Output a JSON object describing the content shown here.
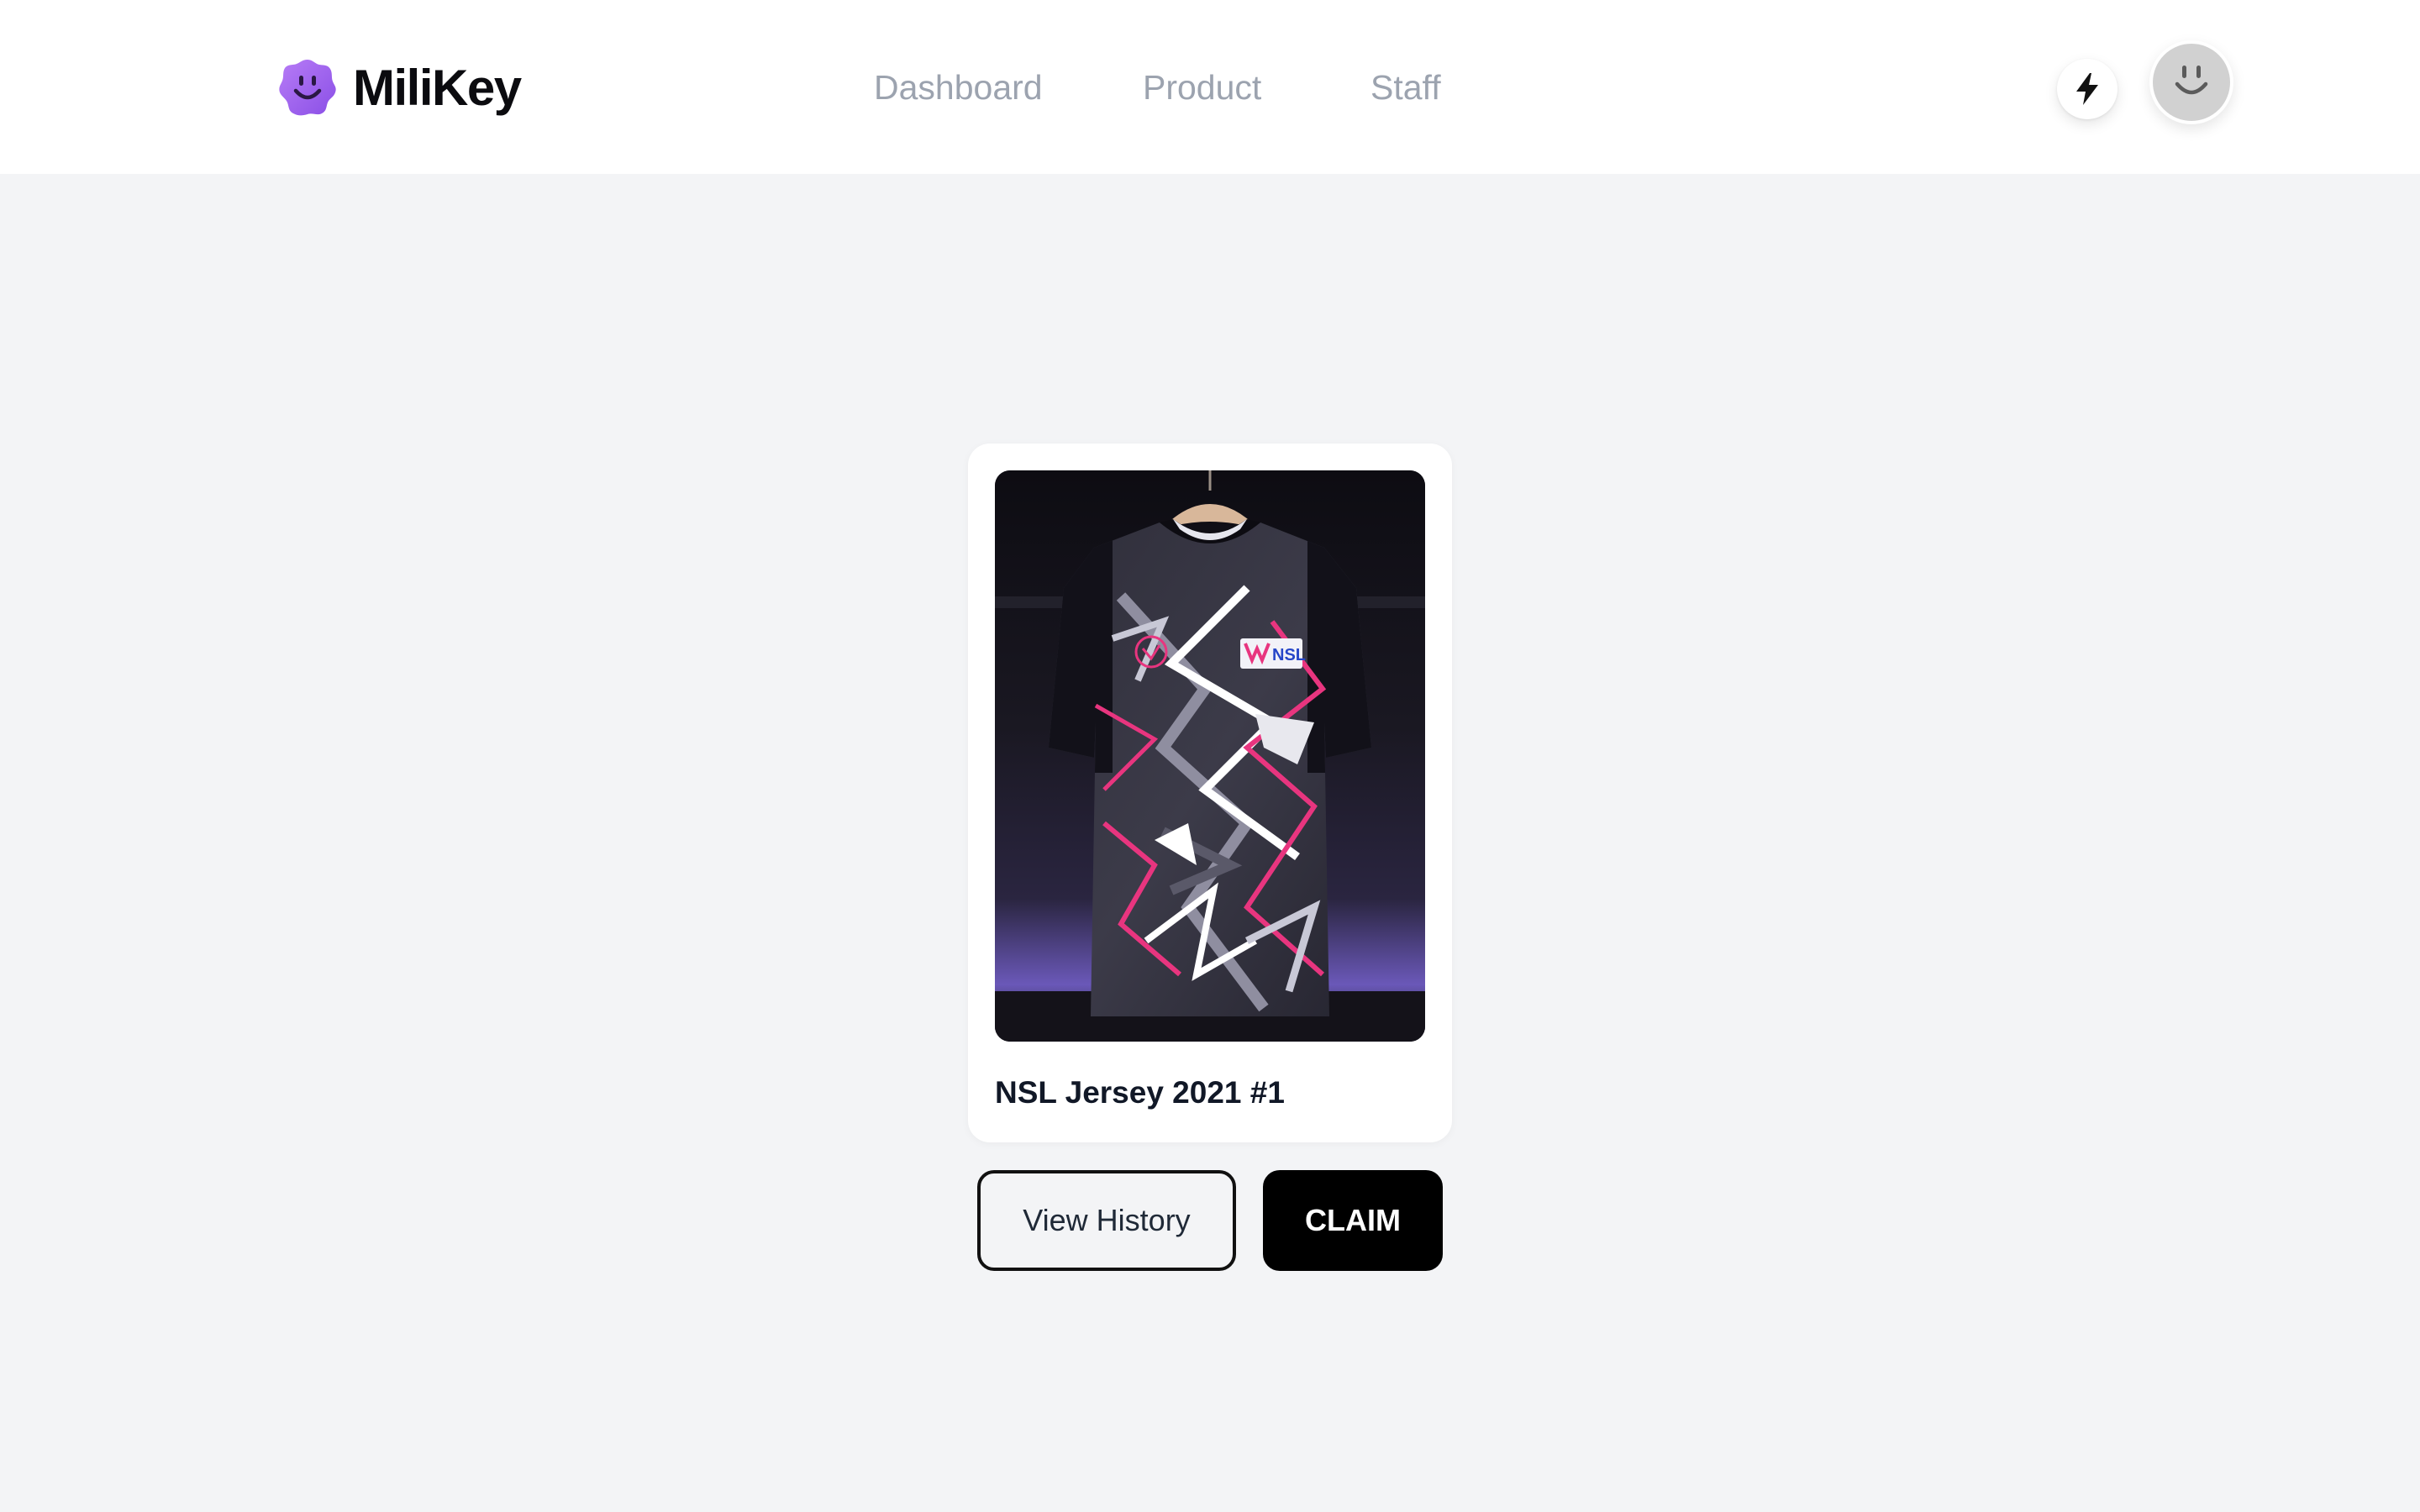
{
  "app": {
    "brand": "MiliKey",
    "brand_color": "#a066f0",
    "logo_icon": "smiley-flower-icon"
  },
  "nav": {
    "items": [
      {
        "label": "Dashboard"
      },
      {
        "label": "Product"
      },
      {
        "label": "Staff"
      }
    ],
    "color": "#9ca3af"
  },
  "header_actions": {
    "bolt_icon": "lightning-bolt-icon",
    "avatar_icon": "smiley-avatar-icon"
  },
  "product": {
    "title": "NSL Jersey 2021 #1",
    "image_icon": "jersey-photo"
  },
  "actions": {
    "view_history_label": "View History",
    "claim_label": "CLAIM"
  }
}
